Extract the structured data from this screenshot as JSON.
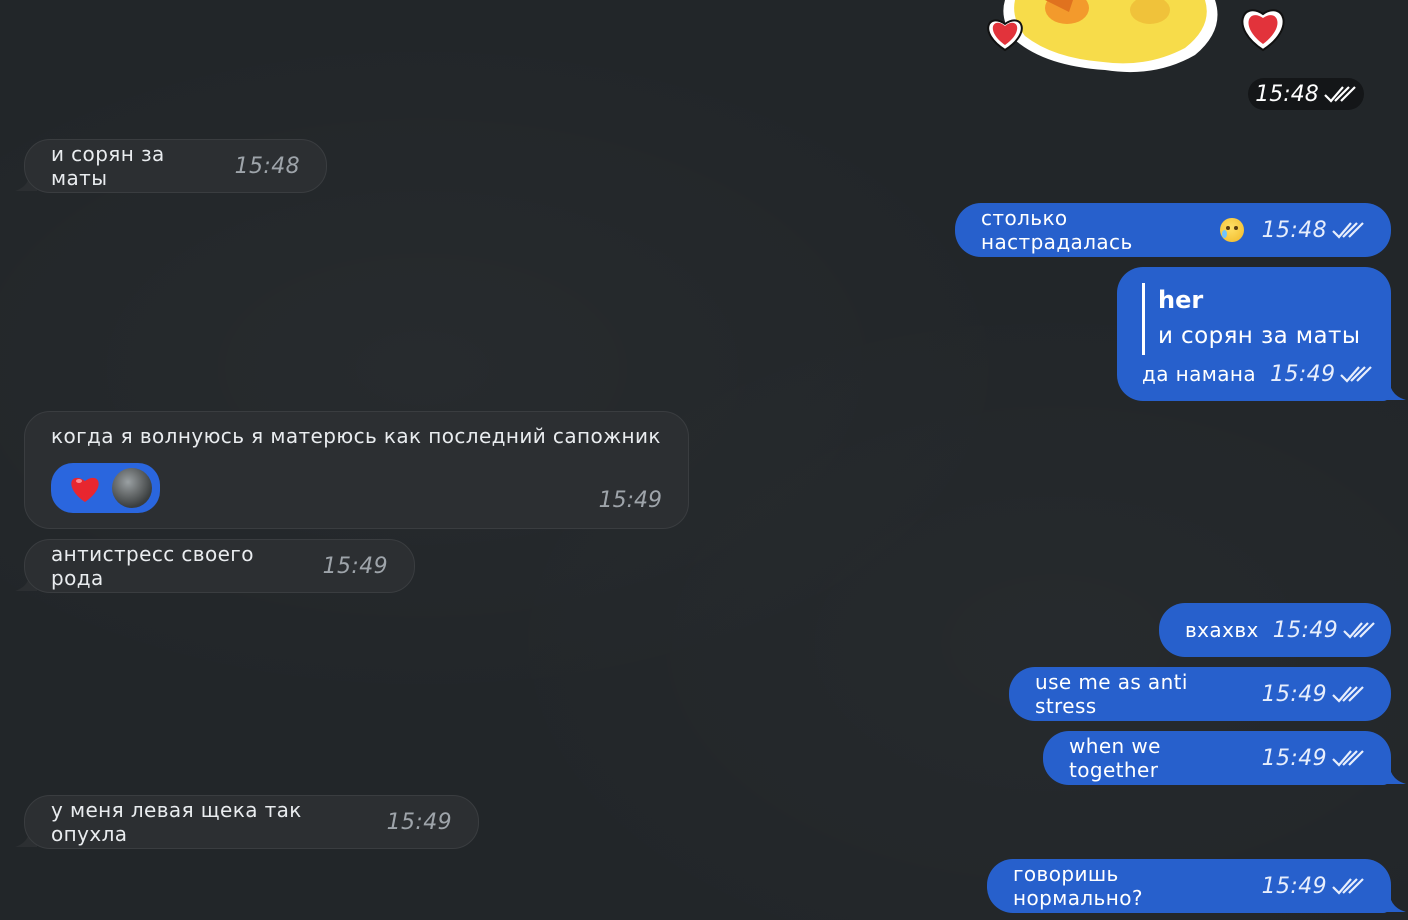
{
  "colors": {
    "background": "#222629",
    "incoming_bubble": "#2c2f32",
    "outgoing_bubble": "#2760cc",
    "reaction_bg": "#2a66de"
  },
  "sticker": {
    "time": "15:48",
    "status_icon": "double-check-icon"
  },
  "messages": [
    {
      "id": "in1",
      "direction": "in",
      "text": "и сорян за маты",
      "time": "15:48"
    },
    {
      "id": "out1",
      "direction": "out",
      "text": "столько настрадалась",
      "emoji": "crying-face-emoji",
      "time": "15:48",
      "status_icon": "double-check-icon"
    },
    {
      "id": "out2",
      "direction": "out",
      "reply": {
        "name": "her",
        "text": "и сорян за маты"
      },
      "text": "да намана",
      "time": "15:49",
      "status_icon": "double-check-icon"
    },
    {
      "id": "in2",
      "direction": "in",
      "text": "когда я волнуюсь я матерюсь как последний сапожник",
      "time": "15:49",
      "reactions": [
        "heart-emoji",
        "avatar"
      ]
    },
    {
      "id": "in3",
      "direction": "in",
      "text": "антистресс своего рода",
      "time": "15:49"
    },
    {
      "id": "out3",
      "direction": "out",
      "text": "вхахвх",
      "time": "15:49",
      "status_icon": "double-check-icon"
    },
    {
      "id": "out4",
      "direction": "out",
      "text": "use me as anti stress",
      "time": "15:49",
      "status_icon": "double-check-icon"
    },
    {
      "id": "out5",
      "direction": "out",
      "text": "when we together",
      "time": "15:49",
      "status_icon": "double-check-icon"
    },
    {
      "id": "in4",
      "direction": "in",
      "text": "у меня левая щека так опухла",
      "time": "15:49"
    },
    {
      "id": "out6",
      "direction": "out",
      "text": "говоришь нормально?",
      "time": "15:49",
      "status_icon": "double-check-icon"
    }
  ]
}
